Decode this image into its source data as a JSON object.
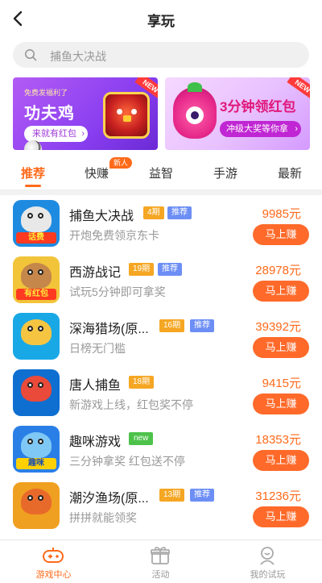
{
  "header": {
    "title": "享玩"
  },
  "search": {
    "placeholder": "捕鱼大决战"
  },
  "banners": [
    {
      "sub": "免费发福利了",
      "title": "功夫鸡",
      "button": "来就有红包",
      "badge": "NEW"
    },
    {
      "title": "3分钟领红包",
      "button": "冲级大奖等你拿",
      "badge": "NEW"
    }
  ],
  "tabs": [
    {
      "label": "推荐",
      "active": true
    },
    {
      "label": "快赚",
      "badge": "新人"
    },
    {
      "label": "益智"
    },
    {
      "label": "手游"
    },
    {
      "label": "最新"
    }
  ],
  "games": [
    {
      "name": "捕鱼大决战",
      "period": "4期",
      "rec": "推荐",
      "desc": "开炮免费领京东卡",
      "reward": "9985元",
      "button": "马上赚",
      "icon_text": "话费",
      "icon_color": "#1f8be0",
      "face_color": "#e8e8e8"
    },
    {
      "name": "西游战记",
      "period": "19期",
      "rec": "推荐",
      "desc": "试玩5分钟即可拿奖",
      "reward": "28978元",
      "button": "马上赚",
      "icon_text": "有红包",
      "icon_color": "#f2c43a",
      "face_color": "#c6874a"
    },
    {
      "name": "深海猎场(原...",
      "period": "16期",
      "rec": "推荐",
      "desc": "日榜无门槛",
      "reward": "39392元",
      "button": "马上赚",
      "icon_text": "",
      "icon_color": "#19a8e6",
      "face_color": "#f5c542"
    },
    {
      "name": "唐人捕鱼",
      "period": "18期",
      "rec": "",
      "desc": "新游戏上线，红包奖不停",
      "reward": "9415元",
      "button": "马上赚",
      "icon_text": "",
      "icon_color": "#0e6fd1",
      "face_color": "#e94a3a"
    },
    {
      "name": "趣咪游戏",
      "period": "",
      "rec": "",
      "new": "new",
      "desc": "三分钟拿奖 红包送不停",
      "reward": "18353元",
      "button": "马上赚",
      "icon_text": "趣咪",
      "icon_color": "#2a7fe6",
      "face_color": "#7fc8f5"
    },
    {
      "name": "潮汐渔场(原...",
      "period": "13期",
      "rec": "推荐",
      "desc": "拼拼就能领奖",
      "reward": "31236元",
      "button": "马上赚",
      "icon_text": "",
      "icon_color": "#f0a020",
      "face_color": "#e86a2a"
    }
  ],
  "bottom_nav": [
    {
      "label": "游戏中心",
      "icon": "gamepad-icon",
      "active": true
    },
    {
      "label": "活动",
      "icon": "gift-icon"
    },
    {
      "label": "我的试玩",
      "icon": "user-icon"
    }
  ],
  "colors": {
    "accent": "#ff6a1a",
    "button": "#ff6a2a",
    "period_tag": "#f5a623",
    "rec_tag": "#6c8ef5",
    "new_tag": "#4cc24a"
  }
}
